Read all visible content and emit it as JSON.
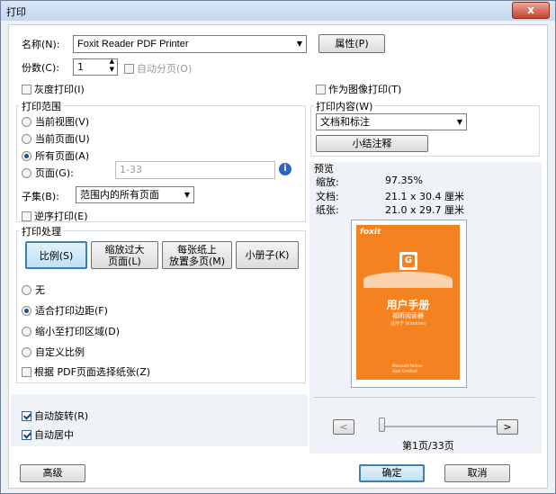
{
  "window": {
    "title": "打印",
    "close_glyph": "x"
  },
  "printer": {
    "name_label": "名称(N):",
    "name_value": "Foxit Reader PDF Printer",
    "properties": "属性(P)"
  },
  "copies": {
    "label": "份数(C):",
    "value": "1",
    "collate": "自动分页(O)"
  },
  "options": {
    "grayscale": "灰度打印(I)",
    "as_image": "作为图像打印(T)"
  },
  "range": {
    "title": "打印范围",
    "current_view": "当前视图(V)",
    "current_page": "当前页面(U)",
    "all_pages": "所有页面(A)",
    "pages": "页面(G):",
    "pages_placeholder": "1-33",
    "info_glyph": "i",
    "subset_label": "子集(B):",
    "subset_value": "范围内的所有页面",
    "reverse": "逆序打印(E)"
  },
  "handling": {
    "title": "打印处理",
    "tabs": [
      "比例(S)",
      "缩放过大\n页面(L)",
      "每张纸上\n放置多页(M)",
      "小册子(K)"
    ],
    "none": "无",
    "fit_margins": "适合打印边距(F)",
    "shrink": "缩小至打印区域(D)",
    "custom": "自定义比例",
    "paper_by_pdf": "根据 PDF页面选择纸张(Z)"
  },
  "auto": {
    "rotate": "自动旋转(R)",
    "center": "自动居中"
  },
  "content": {
    "title": "打印内容(W)",
    "value": "文档和标注",
    "summarize": "小结注释"
  },
  "preview": {
    "title": "预览",
    "zoom_label": "缩放:",
    "zoom_value": "97.35%",
    "doc_label": "文档:",
    "doc_value": "21.1 x 30.4 厘米",
    "paper_label": "纸张:",
    "paper_value": "21.0 x 29.7 厘米",
    "page_counter": "第1页/33页",
    "prev": "<",
    "next": ">",
    "thumb": {
      "brand": "foxit",
      "title": "用户手册",
      "subtitle": "福昕阅读器",
      "subsubtitle": "适用于 Windows",
      "ms_label": "Microsoft Partner",
      "ms_subtext": "Gold Certified"
    }
  },
  "footer": {
    "advanced": "高级",
    "ok": "确定",
    "cancel": "取消"
  },
  "colors": {
    "accent": "#f58220",
    "focus_blue": "#3c7fb1"
  }
}
